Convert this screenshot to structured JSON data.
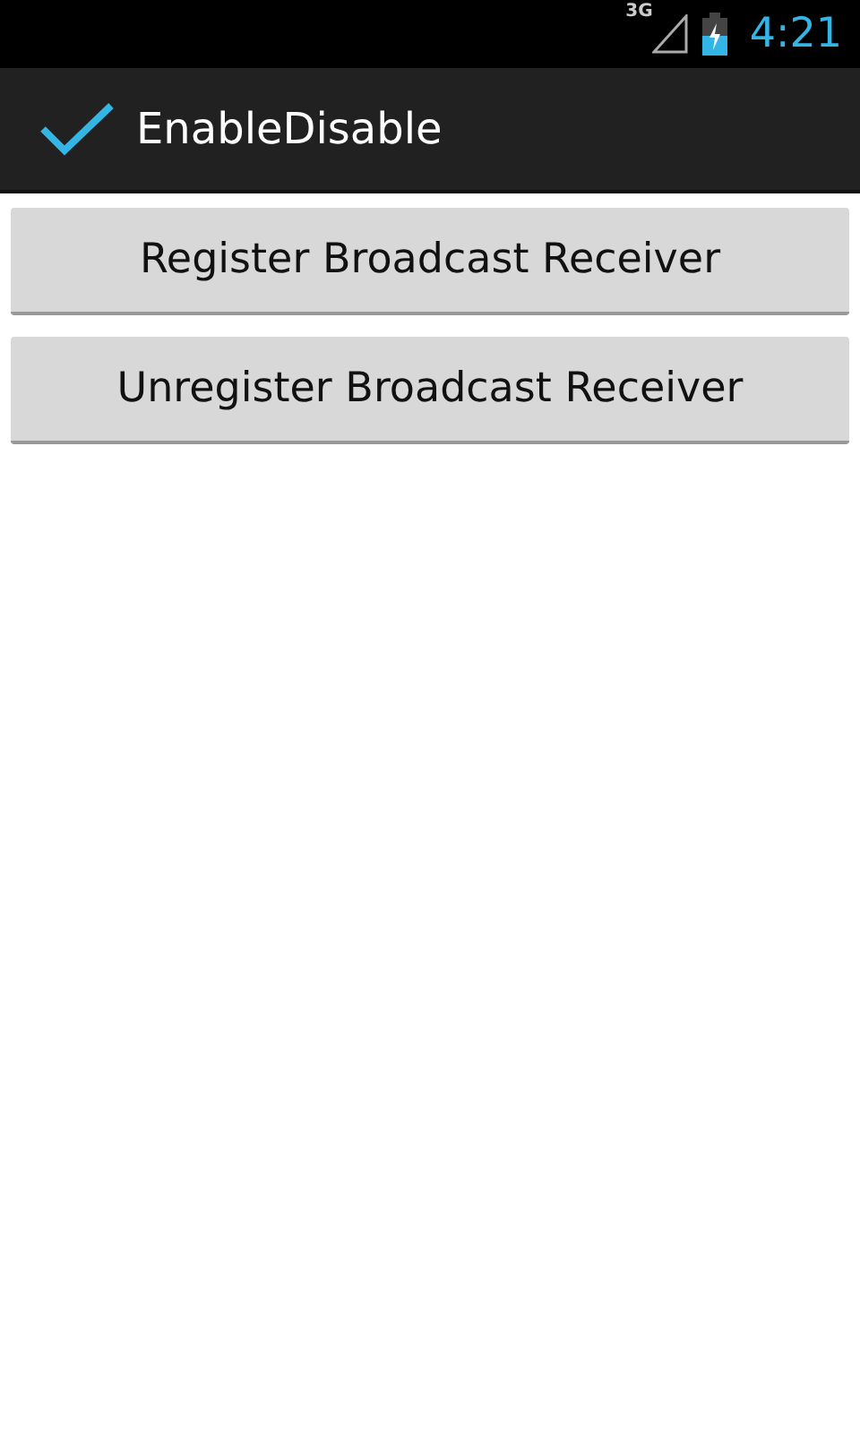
{
  "status_bar": {
    "network": "3G",
    "time": "4:21"
  },
  "action_bar": {
    "title": "EnableDisable"
  },
  "buttons": [
    "Register Broadcast Receiver",
    "Unregister Broadcast Receiver"
  ]
}
